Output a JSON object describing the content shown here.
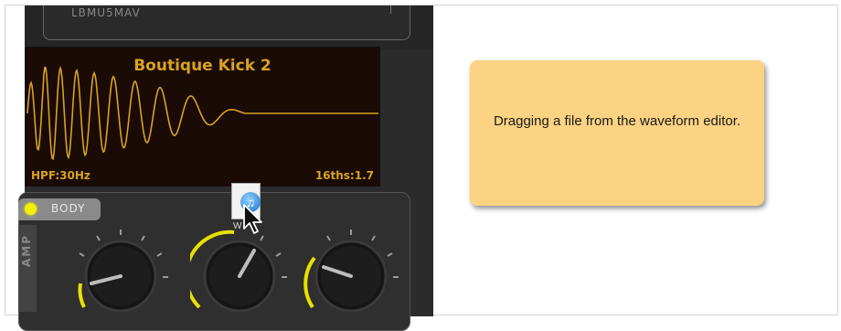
{
  "plugin": {
    "preset_name": "LBMU5MAV",
    "waveform_title": "Boutique Kick 2",
    "hpf_readout": "HPF:30Hz",
    "sixteenths_readout": "16ths:1.7",
    "body_section_label": "BODY",
    "amp_section_label": "AMP",
    "accent_color": "#d9a21f",
    "led_color": "#f4f000",
    "knob_arc_color": "#e8e000"
  },
  "drag": {
    "file_label": "W",
    "icon": "audio-file-icon",
    "cursor_icon": "arrow-cursor-icon"
  },
  "annotation": {
    "text": "Dragging a file from the waveform editor.",
    "background": "#fcd383"
  }
}
